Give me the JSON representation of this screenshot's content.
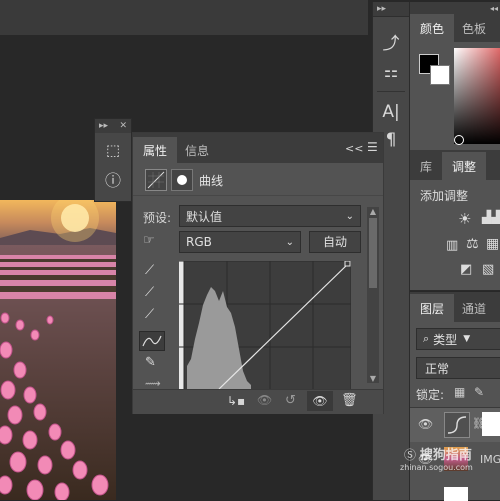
{
  "properties_panel": {
    "tab_properties": "属性",
    "tab_info": "信息",
    "collapse_label": "<<",
    "section_title": "曲线",
    "preset_label": "预设:",
    "preset_value": "默认值",
    "channel_value": "RGB",
    "auto_button": "自动"
  },
  "color_panel": {
    "tab_color": "颜色",
    "tab_swatches": "色板"
  },
  "adjust_panel": {
    "tab_library": "库",
    "tab_adjust": "调整",
    "add_adjust": "添加调整"
  },
  "layers_panel": {
    "tab_layers": "图层",
    "tab_channels": "通道",
    "kind_filter": "类型",
    "blend_mode": "正常",
    "lock_label": "锁定:",
    "layer_name": "IMG"
  },
  "watermark": {
    "site_cn": "搜狗指南",
    "site_url": "zhinan.sogou.com"
  },
  "icons": [
    "cube-icon",
    "info-icon",
    "text-icon",
    "paragraph-icon",
    "brush-settings-icon",
    "eyedropper-icon",
    "curve-icon",
    "pencil-icon",
    "visibility-icon",
    "trash-icon",
    "search-icon"
  ]
}
